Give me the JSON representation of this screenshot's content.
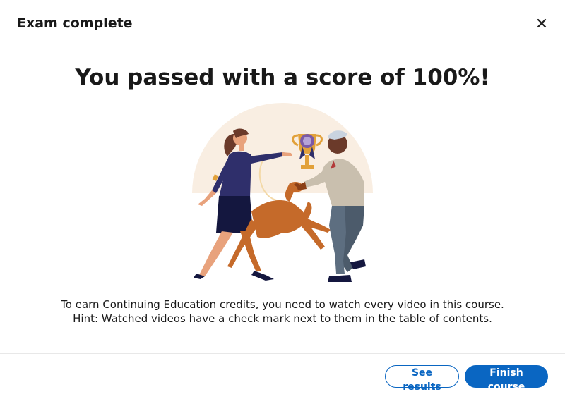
{
  "dialog": {
    "title": "Exam complete",
    "close_icon": "close-icon"
  },
  "result": {
    "headline": "You passed with a score of 100%!"
  },
  "illustration": {
    "description_icon": "celebration-illustration"
  },
  "message": {
    "line1": "To earn Continuing Education credits, you need to watch every video in this course.",
    "line2": "Hint: Watched videos have a check mark next to them in the table of contents."
  },
  "footer": {
    "see_results_label": "See results",
    "finish_course_label": "Finish course"
  },
  "colors": {
    "primary": "#0a66c2",
    "text": "#191919",
    "divider": "#e8e8e8",
    "illustration_bg": "#f9eee2"
  }
}
